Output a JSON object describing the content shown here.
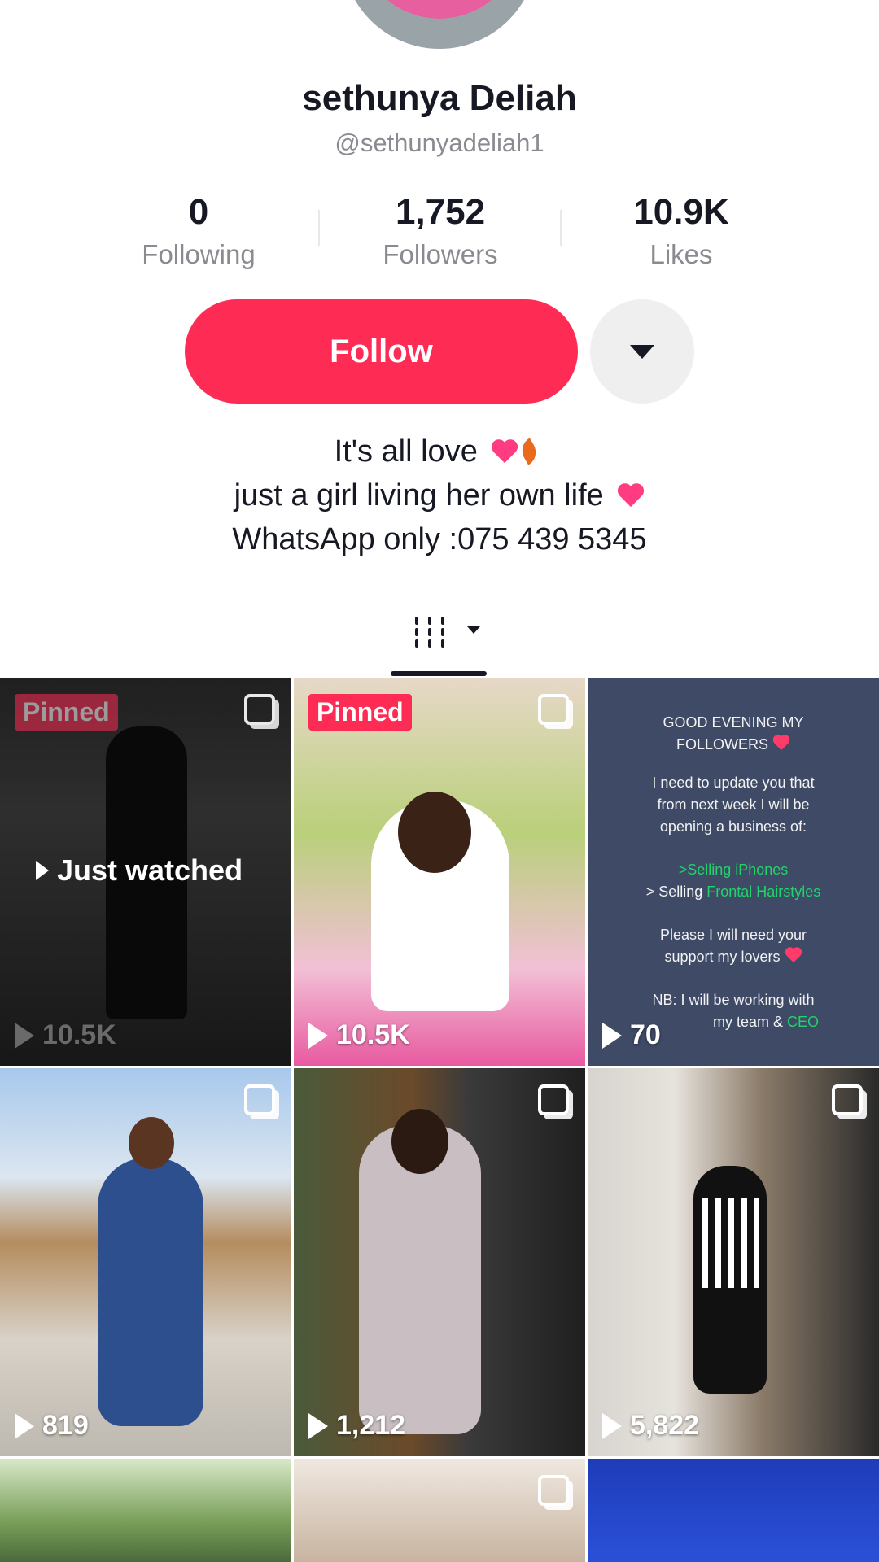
{
  "profile": {
    "name": "sethunya Deliah",
    "handle": "@sethunyadeliah1"
  },
  "stats": [
    {
      "value": "0",
      "label": "Following"
    },
    {
      "value": "1,752",
      "label": "Followers"
    },
    {
      "value": "10.9K",
      "label": "Likes"
    }
  ],
  "actions": {
    "follow_label": "Follow"
  },
  "bio": {
    "line1": "It's all love",
    "line2": "just a girl living her own life",
    "line3": "WhatsApp only :075 439 5345"
  },
  "tabs": {
    "active_icon": "grid-videos-icon"
  },
  "colors": {
    "accent": "#fe2c55",
    "muted_text": "#8a8b91"
  },
  "videos": [
    {
      "pinned_label": "Pinned",
      "views": "10.5K",
      "overlay": "Just watched"
    },
    {
      "pinned_label": "Pinned",
      "views": "10.5K"
    },
    {
      "views": "70"
    },
    {
      "views": "819"
    },
    {
      "views": "1,212"
    },
    {
      "views": "5,822"
    }
  ],
  "notice_post": {
    "l1": "GOOD EVENING  MY",
    "l2": "FOLLOWERS",
    "l3": "I need to update you that",
    "l4": "from next week I will  be",
    "l5": "opening  a business of:",
    "l6": ">Selling iPhones",
    "l7a": "> Selling ",
    "l7b": "Frontal Hairstyles",
    "l8": "Please      I will need your",
    "l9": "support  my lovers",
    "l10a": "NB: I will be working with",
    "l10b": "my team & ",
    "l10c": "CEO"
  }
}
